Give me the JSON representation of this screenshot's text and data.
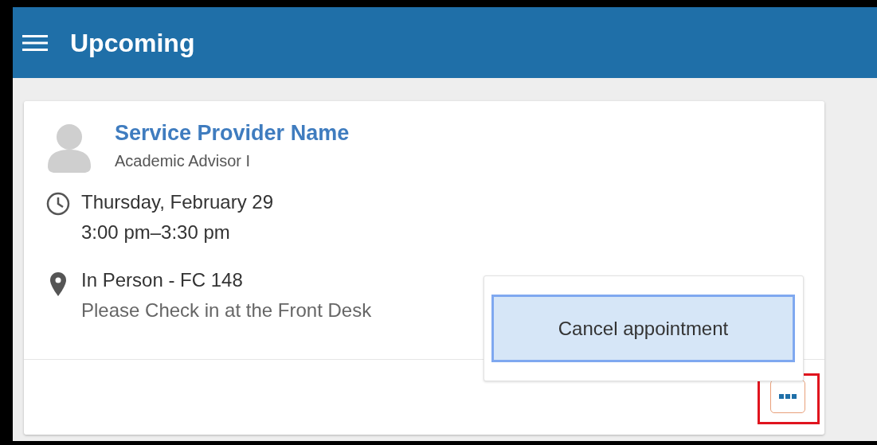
{
  "header": {
    "title": "Upcoming"
  },
  "appointment": {
    "provider_name": "Service Provider Name",
    "provider_role": "Academic Advisor I",
    "date": "Thursday, February 29",
    "time": "3:00 pm–3:30 pm",
    "location": "In Person - FC 148",
    "location_note": "Please Check in at the Front Desk"
  },
  "more_button": {
    "highlighted": true,
    "expanded": true
  },
  "menu": {
    "items": [
      {
        "label": "Cancel appointment",
        "selected": true
      }
    ]
  }
}
